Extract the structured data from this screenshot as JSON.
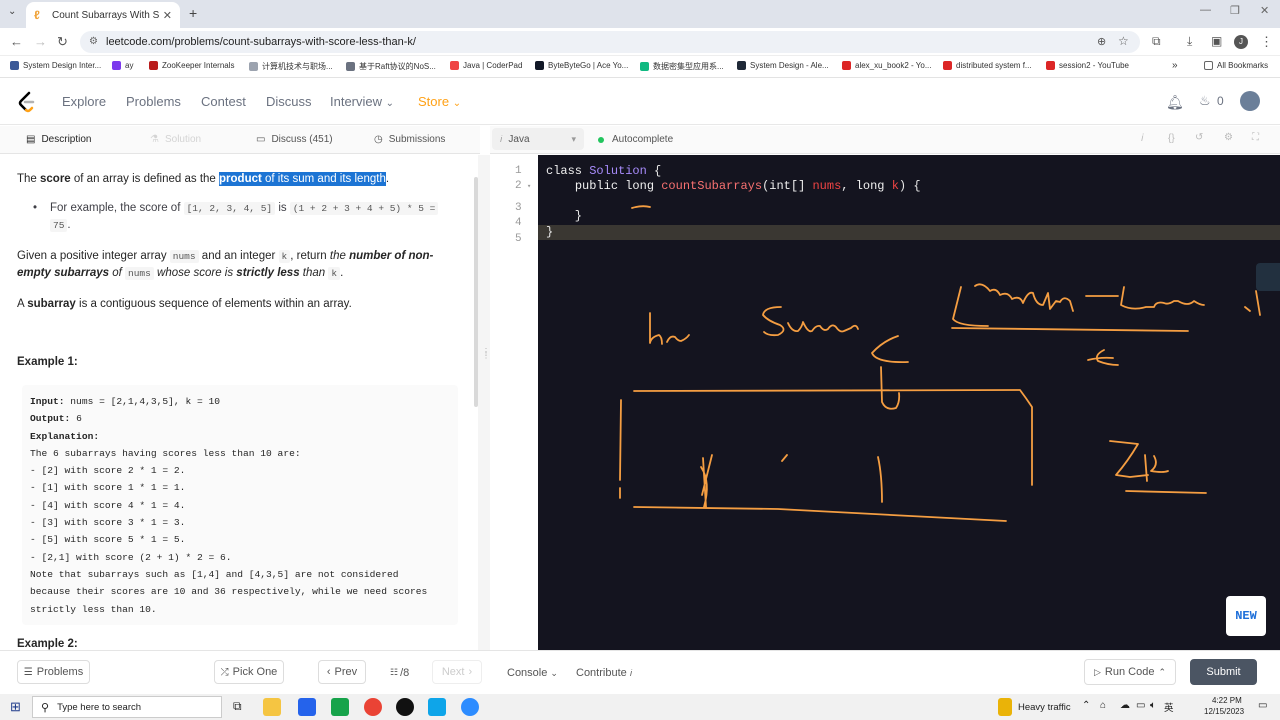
{
  "browser": {
    "tab_title": "Count Subarrays With Score Le...",
    "url": "leetcode.com/problems/count-subarrays-with-score-less-than-k/",
    "bookmarks": [
      "System Design Inter...",
      "ay",
      "ZooKeeper Internals",
      "计算机技术与职场...",
      "基于Raft协议的NoS...",
      "Java | CoderPad",
      "ByteByteGo | Ace Yo...",
      "数据密集型应用系...",
      "System Design - Ale...",
      "alex_xu_book2 - Yo...",
      "distributed system f...",
      "session2 - YouTube"
    ],
    "all_bookmarks": "All Bookmarks"
  },
  "nav": {
    "items": [
      "Explore",
      "Problems",
      "Contest",
      "Discuss",
      "Interview",
      "Store"
    ],
    "notif_count": "0"
  },
  "desc_tabs": [
    "Description",
    "Solution",
    "Discuss (451)",
    "Submissions"
  ],
  "description": {
    "p1_a": "The ",
    "p1_score": "score",
    "p1_b": " of an array is defined as the ",
    "p1_hl_bold": "product",
    "p1_hl": " of its sum and its length",
    "p1_end": ".",
    "bullet_a": "For example, the score of ",
    "bullet_code1": "[1, 2, 3, 4, 5]",
    "bullet_b": " is ",
    "bullet_code2": "(1 + 2 + 3 + 4 + 5) * 5 =",
    "bullet_code3": "75",
    "bullet_end": ".",
    "p2_a": "Given a positive integer array ",
    "p2_nums": "nums",
    "p2_b": " and an integer ",
    "p2_k": "k",
    "p2_c": ", return ",
    "p2_the": "the ",
    "p2_bold": "number of non-",
    "p2_bold2": "empty subarrays",
    "p2_of": " of ",
    "p2_nums2": "nums",
    "p2_whose": " whose score is ",
    "p2_strict": "strictly less",
    "p2_than": " than ",
    "p2_k2": "k",
    "p2_end": ".",
    "p3_a": "A ",
    "p3_bold": "subarray",
    "p3_b": " is a contiguous sequence of elements within an array.",
    "example1": "Example 1:",
    "example2": "Example 2:",
    "ex_input_label": "Input:",
    "ex_input": " nums = [2,1,4,3,5], k = 10",
    "ex_output_label": "Output:",
    "ex_output": " 6",
    "ex_expl_label": "Explanation:",
    "ex_lines": [
      "The 6 subarrays having scores less than 10 are:",
      "- [2] with score 2 * 1 = 2.",
      "- [1] with score 1 * 1 = 1.",
      "- [4] with score 4 * 1 = 4.",
      "- [3] with score 3 * 1 = 3.",
      "- [5] with score 5 * 1 = 5.",
      "- [2,1] with score (2 + 1) * 2 = 6.",
      "Note that subarrays such as [1,4] and [4,3,5] are not considered",
      "because their scores are 10 and 36 respectively, while we need scores",
      "strictly less than 10."
    ]
  },
  "editor": {
    "language": "Java",
    "autocomplete": "Autocomplete",
    "line_numbers": [
      "1",
      "2",
      "3",
      "4",
      "5"
    ],
    "new_badge": "NEW"
  },
  "bottom": {
    "problems": "Problems",
    "pick_one": "Pick One",
    "prev": "Prev",
    "page": "/8",
    "next": "Next",
    "console": "Console",
    "contribute": "Contribute",
    "run_code": "Run Code",
    "submit": "Submit"
  },
  "taskbar": {
    "search": "Type here to search",
    "traffic": "Heavy traffic",
    "ime": "英",
    "time": "4:22 PM",
    "date": "12/15/2023"
  },
  "colors": {
    "accent": "#ffa116",
    "ink": "#f59e42",
    "editor_bg": "#14141f",
    "submit_bg": "#4b5563"
  }
}
